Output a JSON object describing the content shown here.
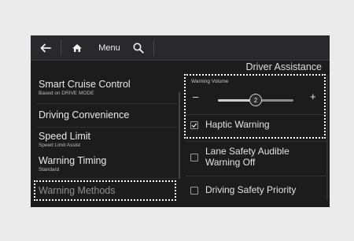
{
  "topbar": {
    "back_icon": "back-arrow-icon",
    "home_icon": "home-icon",
    "menu_label": "Menu",
    "search_icon": "search-icon"
  },
  "page": {
    "title": "Driver Assistance"
  },
  "left_menu": [
    {
      "title": "Smart Cruise Control",
      "subtitle": "Based on DRIVE MODE"
    },
    {
      "title": "Driving Convenience",
      "subtitle": ""
    },
    {
      "title": "Speed Limit",
      "subtitle": "Speed Limit Assist"
    },
    {
      "title": "Warning Timing",
      "subtitle": "Standard"
    },
    {
      "title": "Warning Methods",
      "subtitle": "",
      "selected": true
    }
  ],
  "warning_volume": {
    "label": "Warning Volume",
    "minus": "–",
    "plus": "+",
    "value": "2",
    "level_fraction": 0.5
  },
  "options": [
    {
      "label": "Haptic Warning",
      "checked": true
    },
    {
      "label": "Lane Safety Audible",
      "label2": "Warning Off",
      "checked": false
    },
    {
      "label": "Driving Safety Priority",
      "checked": false
    }
  ],
  "colors": {
    "screen_bg": "#1c1c1d",
    "topbar_bg": "#29292b",
    "highlight": "#ffffff",
    "page_bg": "#ebebeb"
  }
}
